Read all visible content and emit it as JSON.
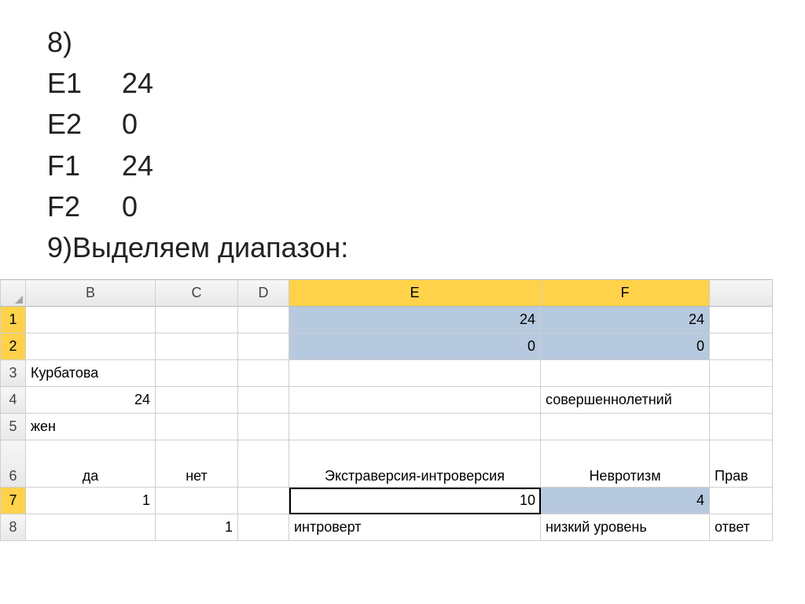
{
  "text": {
    "line1": "8)",
    "e1_ref": "E1",
    "e1_val": "24",
    "e2_ref": "E2",
    "e2_val": "0",
    "f1_ref": "F1",
    "f1_val": "24",
    "f2_ref": "F2",
    "f2_val": "0",
    "line6": "9)Выделяем диапазон:"
  },
  "columns": {
    "B": "B",
    "C": "C",
    "D": "D",
    "E": "E",
    "F": "F"
  },
  "rowh": {
    "r1": "1",
    "r2": "2",
    "r3": "3",
    "r4": "4",
    "r5": "5",
    "r6": "6",
    "r7": "7",
    "r8": "8"
  },
  "cells": {
    "E1": "24",
    "F1": "24",
    "E2": "0",
    "F2": "0",
    "B3": "Курбатова",
    "B4": "24",
    "F4": "совершеннолетний",
    "B5": "жен",
    "B6": "да",
    "C6": "нет",
    "E6": "Экстраверсия-интроверсия",
    "F6": "Невротизм",
    "G6": "Прав",
    "B7": "1",
    "E7": "10",
    "F7": "4",
    "C8": "1",
    "E8": "интроверт",
    "F8": "низкий уровень",
    "G8": "ответ"
  }
}
